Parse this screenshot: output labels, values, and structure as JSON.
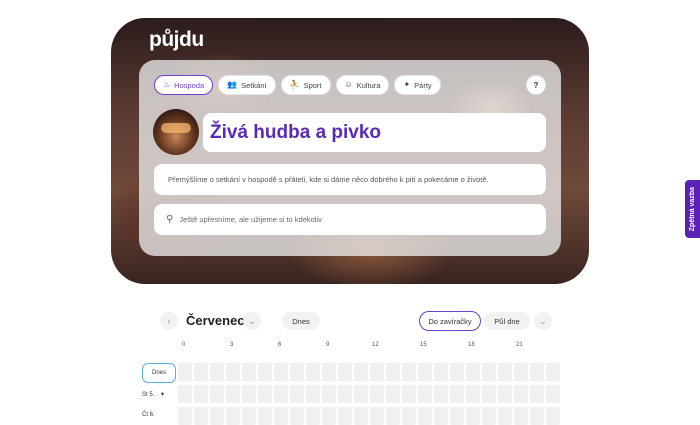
{
  "brand": {
    "logo": "půjdu"
  },
  "tabs": [
    {
      "label": "Hospoda",
      "icon": "beer-icon",
      "active": true
    },
    {
      "label": "Setkání",
      "icon": "people-icon",
      "active": false
    },
    {
      "label": "Sport",
      "icon": "sport-icon",
      "active": false
    },
    {
      "label": "Kultura",
      "icon": "masks-icon",
      "active": false
    },
    {
      "label": "Párty",
      "icon": "party-icon",
      "active": false
    }
  ],
  "help_label": "?",
  "event": {
    "title": "Živá hudba a pivko",
    "description": "Přemýšlíme o setkání v hospodě s přáteli, kde si dáme něco dobrého k pití a pokecáme o životě.",
    "place_placeholder": "Ještě upřesníme, ale užijeme si to kdekoliv"
  },
  "feedback_label": "Zpětná vazba",
  "calendar": {
    "month": "Červenec",
    "today_button": "Dnes",
    "range_active": "Do zavíračky",
    "range_other": "Půl dne",
    "hour_ticks": [
      "0",
      "3",
      "6",
      "9",
      "12",
      "15",
      "18",
      "21"
    ],
    "rows": [
      "Dnes",
      "St 5.",
      "Čt 6."
    ]
  },
  "colors": {
    "accent": "#6d3fd0",
    "feedback_bg": "#5b21b6",
    "today_border": "#5ab0d8"
  }
}
